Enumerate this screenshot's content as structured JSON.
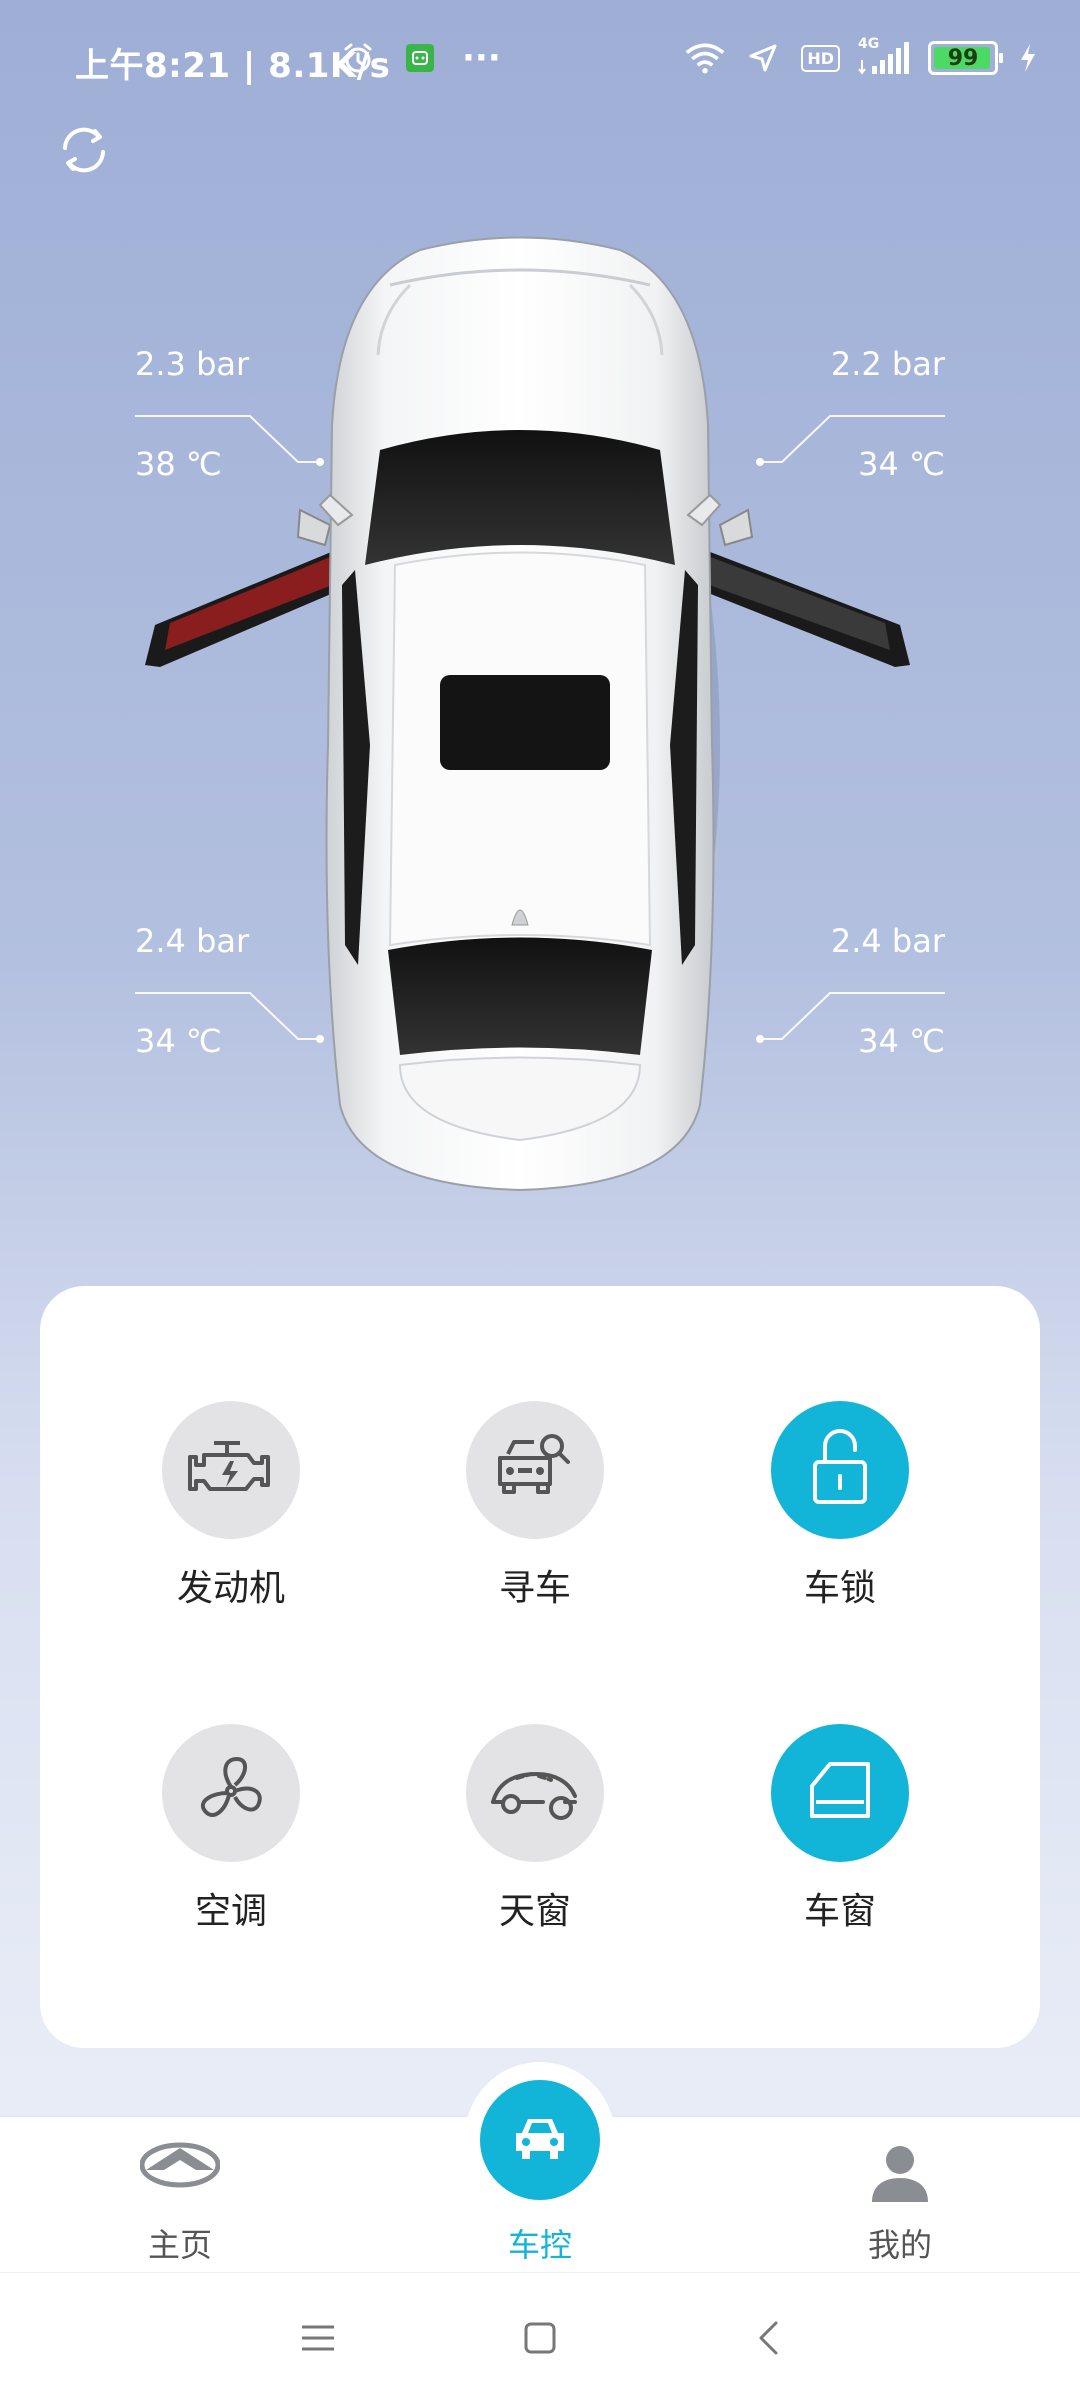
{
  "status_bar": {
    "time": "上午8:21 | 8.1K/s",
    "more": "···",
    "network": "4G",
    "hd": "HD",
    "battery": "99"
  },
  "tires": {
    "front_left": {
      "pressure": "2.3 bar",
      "temp": "38 ℃"
    },
    "front_right": {
      "pressure": "2.2 bar",
      "temp": "34 ℃"
    },
    "rear_left": {
      "pressure": "2.4 bar",
      "temp": "34 ℃"
    },
    "rear_right": {
      "pressure": "2.4 bar",
      "temp": "34 ℃"
    }
  },
  "controls": [
    {
      "label": "发动机",
      "icon": "engine-icon",
      "active": false
    },
    {
      "label": "寻车",
      "icon": "find-car-icon",
      "active": false
    },
    {
      "label": "车锁",
      "icon": "unlock-icon",
      "active": true
    },
    {
      "label": "空调",
      "icon": "fan-icon",
      "active": false
    },
    {
      "label": "天窗",
      "icon": "sunroof-icon",
      "active": false
    },
    {
      "label": "车窗",
      "icon": "window-icon",
      "active": true
    }
  ],
  "bottom_nav": [
    {
      "label": "主页",
      "icon": "infiniti-logo-icon",
      "active": false
    },
    {
      "label": "车控",
      "icon": "car-icon",
      "active": true
    },
    {
      "label": "我的",
      "icon": "user-icon",
      "active": false
    }
  ],
  "colors": {
    "accent": "#12b4d8",
    "inactive_circle": "#e3e3e5",
    "background_top": "#9eaed6",
    "background_bottom": "#eef1f8"
  }
}
